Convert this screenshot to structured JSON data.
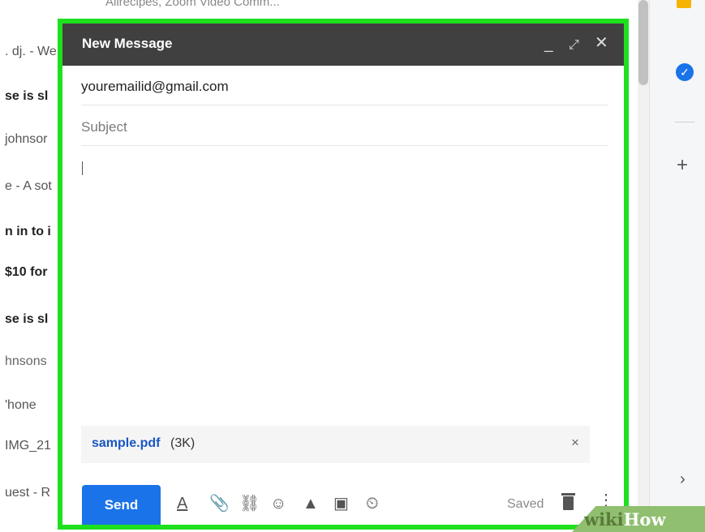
{
  "inbox": {
    "top_text": "Allrecipes, Zoom Video Comm...",
    "rows": [
      {
        "text": ". dj. - We",
        "style": "muted"
      },
      {
        "text": "se is sl",
        "style": "bold"
      },
      {
        "text": "johnsor",
        "style": "muted"
      },
      {
        "text": "e - A sot",
        "style": "muted"
      },
      {
        "text": "n in to i",
        "style": "bold"
      },
      {
        "text": "$10 for",
        "style": "bold"
      },
      {
        "text": "se is sl",
        "style": "bold"
      },
      {
        "text": "hnsons",
        "style": "faded"
      },
      {
        "text": "'hone",
        "style": "muted"
      },
      {
        "text": "IMG_21",
        "style": "muted"
      },
      {
        "text": "uest - R",
        "style": "muted"
      }
    ]
  },
  "compose": {
    "title": "New Message",
    "header_icons": {
      "minimize": "_",
      "expand": "⤢",
      "close": "✕"
    },
    "to_value": "youremailid@gmail.com",
    "subject_placeholder": "Subject",
    "attachment": {
      "name": "sample.pdf",
      "size": "(3K)",
      "remove": "×"
    },
    "send_label": "Send",
    "toolbar_icons": {
      "formatting": "A",
      "attach": "📎",
      "link": "⛓",
      "emoji": "☺",
      "drive": "▲",
      "photo": "▣",
      "confidential": "⏲"
    },
    "status": "Saved",
    "more": "⋮"
  },
  "rail": {
    "plus": "+",
    "chevron": "›",
    "tasks": "✓"
  },
  "watermark": {
    "wiki": "wiki",
    "how": "How"
  },
  "colors": {
    "highlight": "#1ee01e",
    "header_bg": "#404040",
    "send_bg": "#1a73e8",
    "attachment_link": "#1a56c4"
  }
}
